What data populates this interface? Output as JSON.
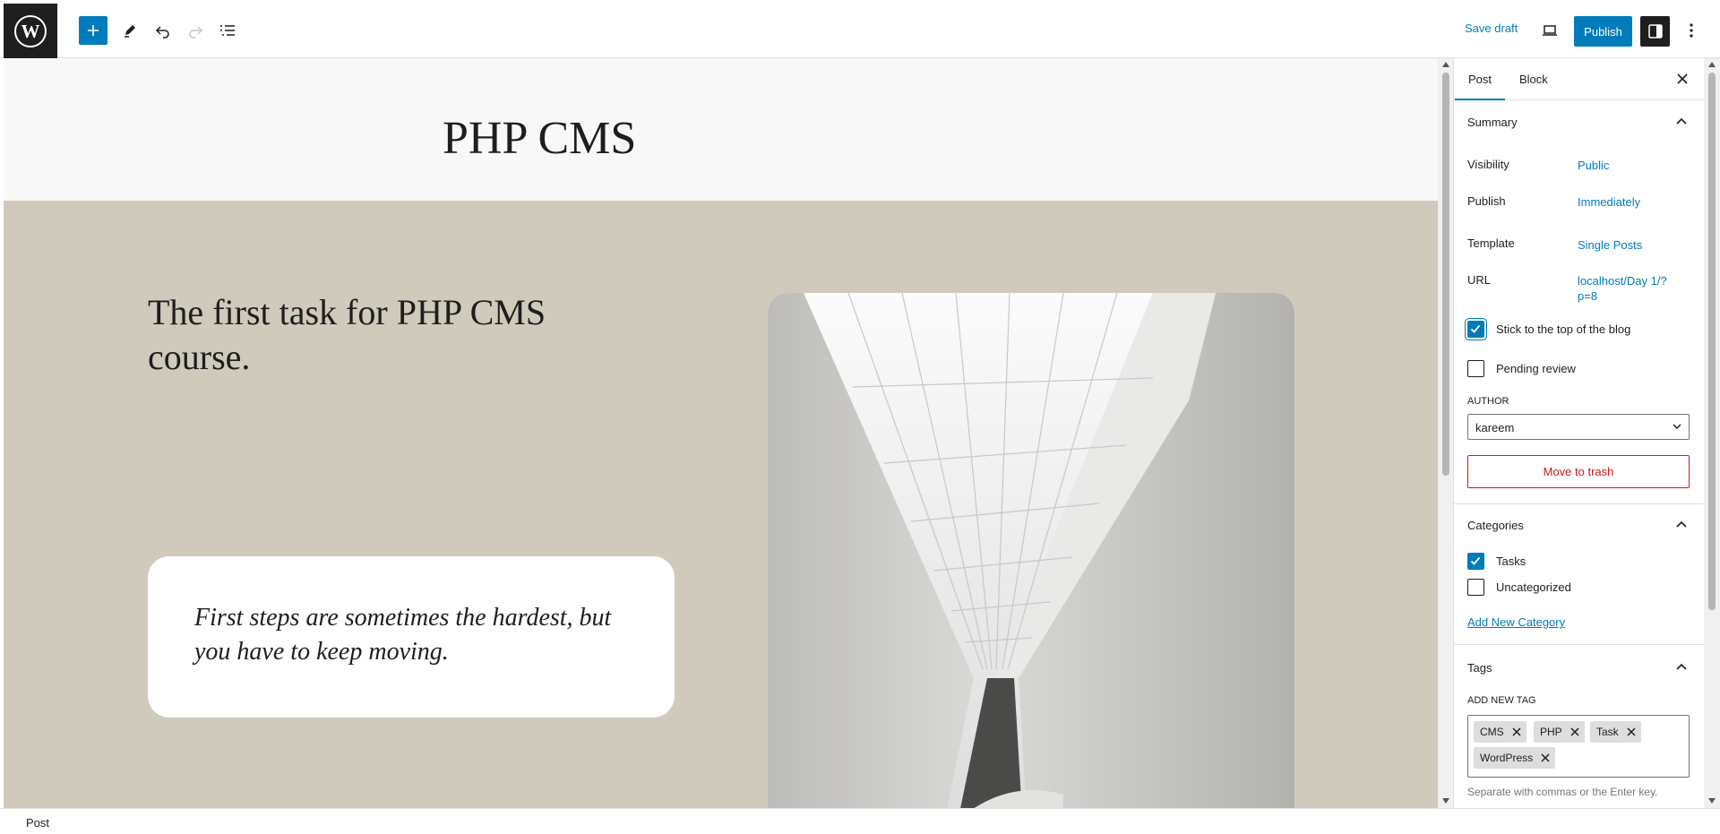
{
  "toolbar": {
    "save_draft": "Save draft",
    "publish": "Publish"
  },
  "canvas": {
    "site_title": "PHP CMS",
    "post_title": "The first task for PHP CMS course.",
    "quote": "First steps are sometimes the hardest, but you have to keep moving."
  },
  "sidebar": {
    "tabs": [
      {
        "label": "Post",
        "active": true
      },
      {
        "label": "Block",
        "active": false
      }
    ],
    "summary": {
      "heading": "Summary",
      "visibility_label": "Visibility",
      "visibility_value": "Public",
      "publish_label": "Publish",
      "publish_value": "Immediately",
      "template_label": "Template",
      "template_value": "Single Posts",
      "url_label": "URL",
      "url_value": "localhost/Day 1/?p=8",
      "sticky_label": "Stick to the top of the blog",
      "sticky_checked": true,
      "pending_label": "Pending review",
      "pending_checked": false,
      "author_label": "AUTHOR",
      "author_value": "kareem",
      "trash_label": "Move to trash"
    },
    "categories": {
      "heading": "Categories",
      "items": [
        {
          "label": "Tasks",
          "checked": true
        },
        {
          "label": "Uncategorized",
          "checked": false
        }
      ],
      "add_new": "Add New Category"
    },
    "tags": {
      "heading": "Tags",
      "add_label": "ADD NEW TAG",
      "items": [
        "CMS",
        "PHP",
        "Task",
        "WordPress"
      ],
      "help": "Separate with commas or the Enter key."
    }
  },
  "footer": {
    "breadcrumb": "Post"
  },
  "colors": {
    "accent": "#007cba",
    "hero_bg": "#cfcabc",
    "danger": "#cc1818"
  }
}
